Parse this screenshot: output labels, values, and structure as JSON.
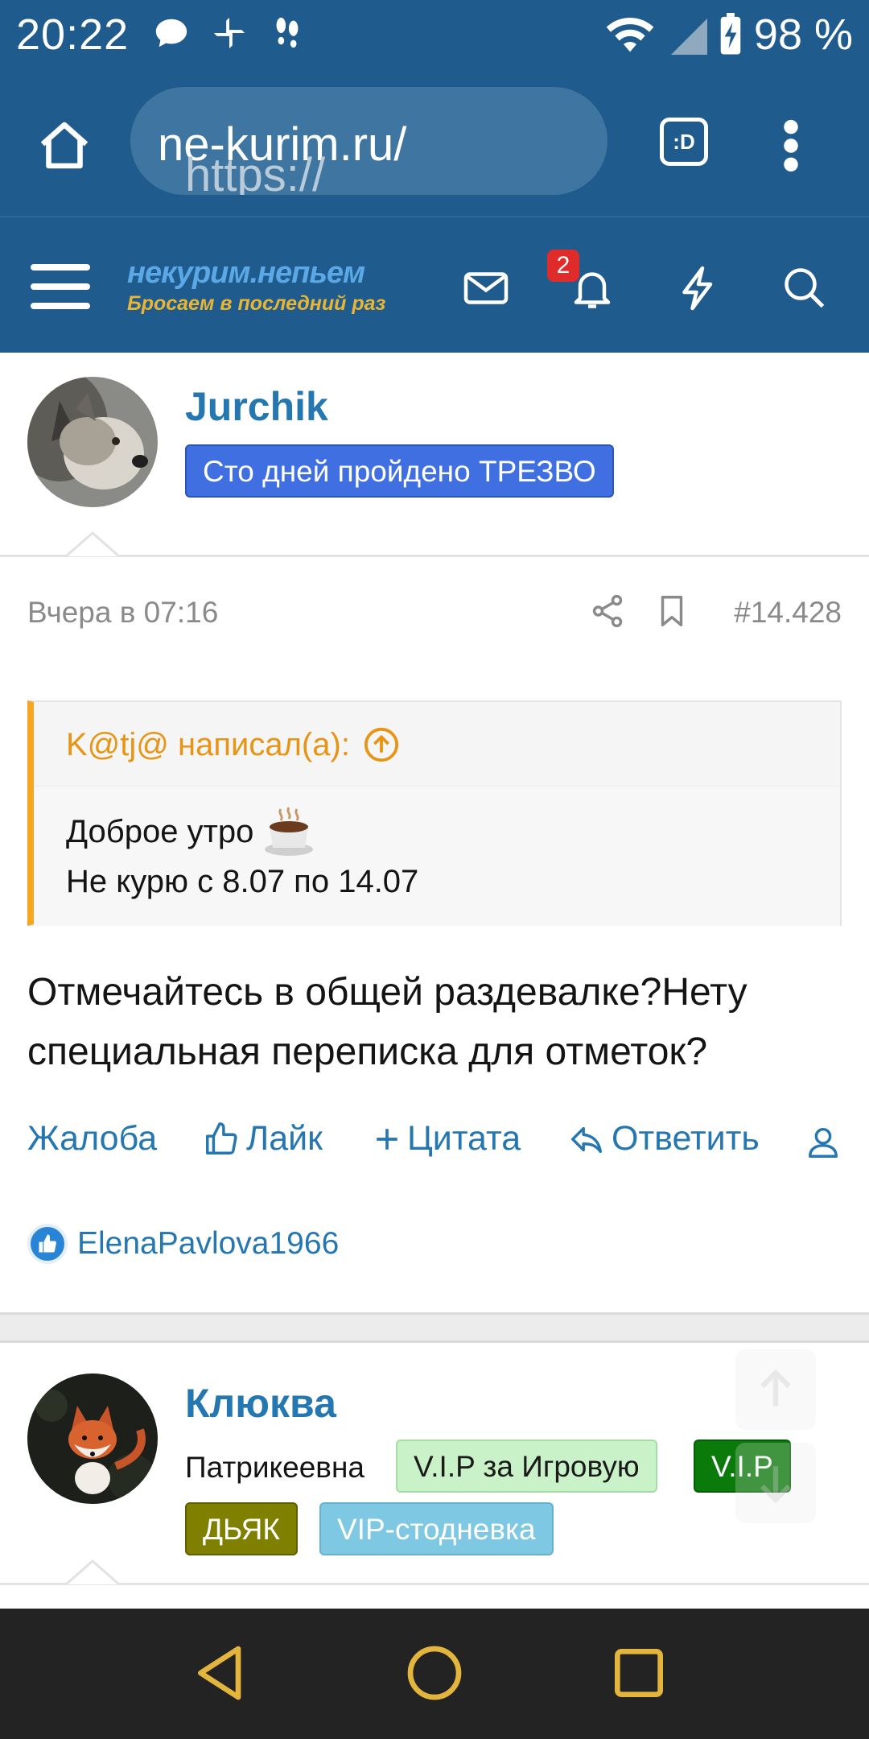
{
  "status_bar": {
    "time": "20:22",
    "battery": "98 %",
    "icons": [
      "chat-icon",
      "pinwheel-icon",
      "footsteps-icon",
      "wifi-icon",
      "signal-icon",
      "battery-icon"
    ]
  },
  "browser": {
    "url_scheme": "https://",
    "url_host": "ne-kurim.ru/",
    "tab_label": ":D"
  },
  "site_header": {
    "logo_top": "некурим.непьем",
    "logo_bottom": "Бросаем в последний раз",
    "notification_count": "2"
  },
  "post1": {
    "username": "Jurchik",
    "user_badge": "Сто дней пройдено ТРЕЗВО",
    "date": "Вчера в 07:16",
    "post_number": "#14.428",
    "quote": {
      "author_line": "K@tj@ написал(а):",
      "line1": "Доброе утро",
      "line2": "Не курю с 8.07 по 14.07"
    },
    "text": "Отмечайтесь в общей раздевалке?Нету специальная переписка для отметок?",
    "actions": {
      "report": "Жалоба",
      "like": "Лайк",
      "quote": "Цитата",
      "reply": "Ответить"
    },
    "reaction_user": "ElenaPavlova1966"
  },
  "post2": {
    "username": "Клюква",
    "title": "Патрикеевна",
    "badges": [
      {
        "label": "V.I.P за Игровую",
        "bg": "#c9f2c9",
        "fg": "#1a1a1a"
      },
      {
        "label": "V.I.P",
        "bg": "#0a7a0a",
        "fg": "#ffffff"
      },
      {
        "label": "ДЬЯК",
        "bg": "#808000",
        "fg": "#ffffff"
      },
      {
        "label": "VIP-стодневка",
        "bg": "#7ec8e3",
        "fg": "#ffffff"
      }
    ]
  },
  "colors": {
    "header_bg": "#1f5b8c",
    "link": "#2577b1",
    "quote_accent": "#f5a623",
    "badge_blue": "#3f6fe0"
  }
}
